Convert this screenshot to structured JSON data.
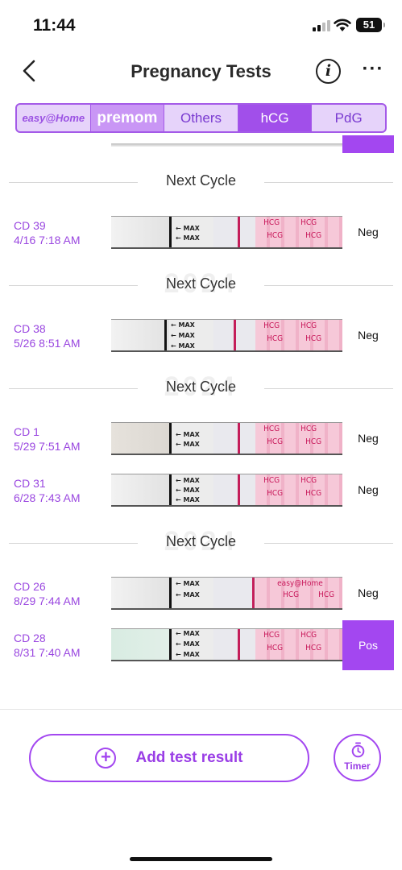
{
  "status": {
    "time": "11:44",
    "battery": "51"
  },
  "nav": {
    "title": "Pregnancy Tests",
    "info_label": "i",
    "more_label": "···"
  },
  "tabs": [
    {
      "label": "easy@Home",
      "active": false
    },
    {
      "label": "premom",
      "active": false
    },
    {
      "label": "Others",
      "active": false
    },
    {
      "label": "hCG",
      "active": true
    },
    {
      "label": "PdG",
      "active": false
    }
  ],
  "divider_label": "Next Cycle",
  "watermark_year": "2024",
  "strip_text": {
    "max": "MAX",
    "hcg": "HCG",
    "brand": "easy@Home"
  },
  "tests": [
    {
      "cd": "CD 39",
      "datetime": "4/16 7:18 AM",
      "result": "Neg"
    },
    {
      "cd": "CD 38",
      "datetime": "5/26 8:51 AM",
      "result": "Neg"
    },
    {
      "cd": "CD 1",
      "datetime": "5/29 7:51 AM",
      "result": "Neg"
    },
    {
      "cd": "CD 31",
      "datetime": "6/28 7:43 AM",
      "result": "Neg"
    },
    {
      "cd": "CD 26",
      "datetime": "8/29 7:44 AM",
      "result": "Neg"
    },
    {
      "cd": "CD 28",
      "datetime": "8/31 7:40 AM",
      "result": "Pos"
    }
  ],
  "bottom": {
    "add_label": "Add test result",
    "timer_label": "Timer"
  },
  "colors": {
    "accent": "#a347f0",
    "tab_bg": "#e6d3fa",
    "strip_pink": "#f6c8d8"
  },
  "icons": [
    "back-chevron-icon",
    "info-icon",
    "more-dots-icon",
    "plus-circle-icon",
    "stopwatch-icon"
  ]
}
